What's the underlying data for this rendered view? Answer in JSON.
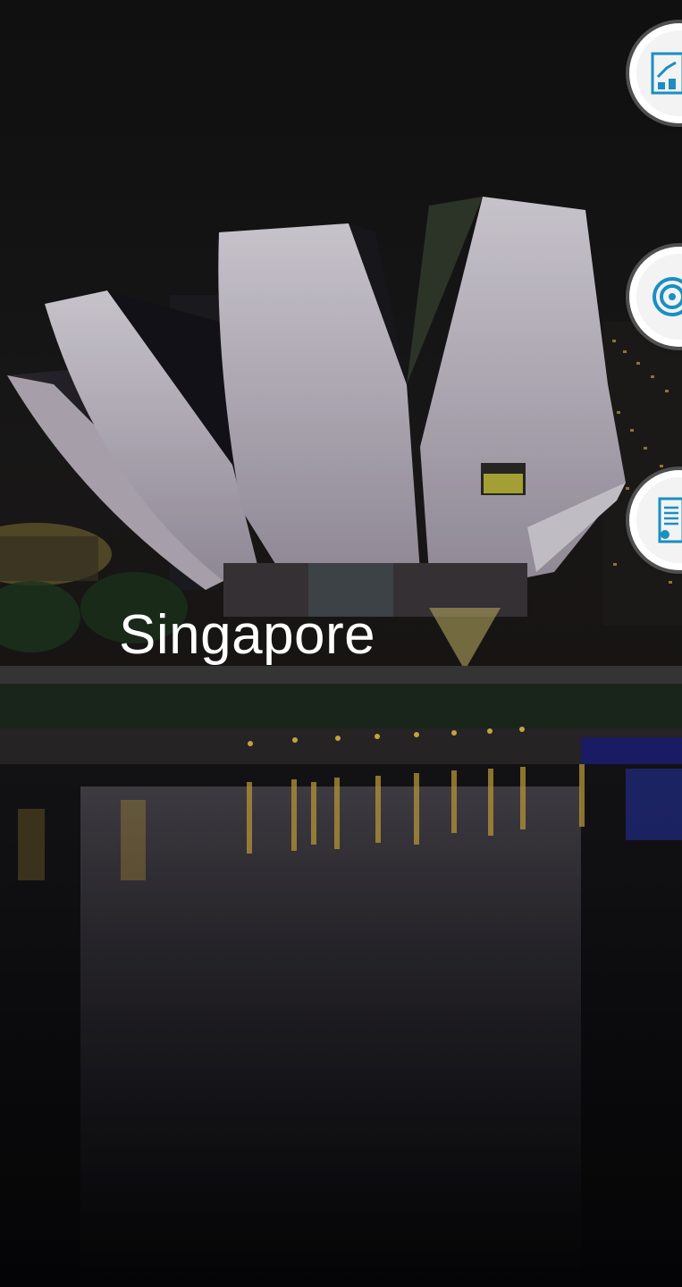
{
  "slide": {
    "city_name": "Singapore"
  },
  "side_buttons": [
    {
      "icon": "chart-growth-icon"
    },
    {
      "icon": "target-rings-icon"
    },
    {
      "icon": "document-list-icon"
    }
  ],
  "colors": {
    "accent": "#1a8fc2",
    "title_text": "#ffffff"
  }
}
